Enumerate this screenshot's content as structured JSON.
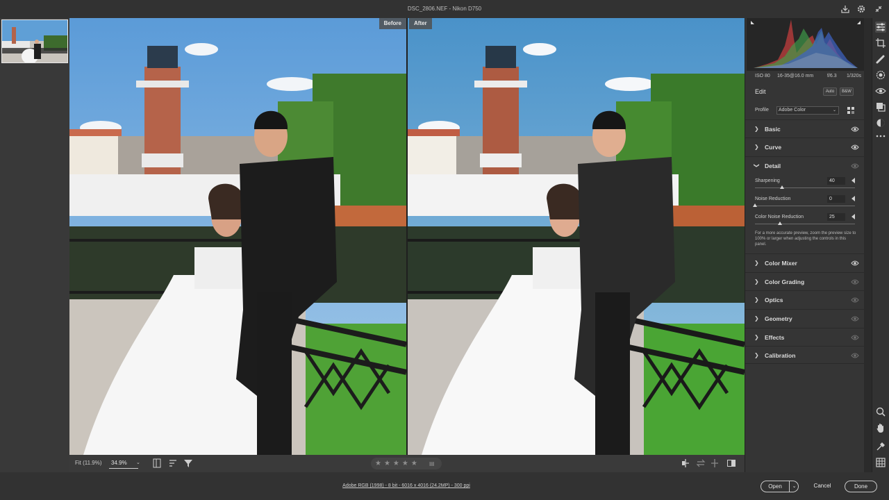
{
  "window": {
    "title": "DSC_2806.NEF  -  Nikon D750"
  },
  "labels": {
    "before": "Before",
    "after": "After"
  },
  "camera_info": {
    "iso": "ISO 80",
    "lens": "16-35@16.0 mm",
    "aperture": "f/6.3",
    "shutter": "1/320s"
  },
  "edit": {
    "title": "Edit",
    "auto_label": "Auto",
    "bw_label": "B&W"
  },
  "profile": {
    "label": "Profile",
    "value": "Adobe Color"
  },
  "sections": [
    {
      "name": "Basic",
      "expanded": false,
      "visible": true
    },
    {
      "name": "Curve",
      "expanded": false,
      "visible": true
    },
    {
      "name": "Detail",
      "expanded": true,
      "visible": false
    },
    {
      "name": "Color Mixer",
      "expanded": false,
      "visible": true
    },
    {
      "name": "Color Grading",
      "expanded": false,
      "visible": false
    },
    {
      "name": "Optics",
      "expanded": false,
      "visible": false
    },
    {
      "name": "Geometry",
      "expanded": false,
      "visible": false
    },
    {
      "name": "Effects",
      "expanded": false,
      "visible": false
    },
    {
      "name": "Calibration",
      "expanded": false,
      "visible": false
    }
  ],
  "detail": {
    "sliders": [
      {
        "label": "Sharpening",
        "value": "40",
        "fraction": 0.27
      },
      {
        "label": "Noise Reduction",
        "value": "0",
        "fraction": 0.0
      },
      {
        "label": "Color Noise Reduction",
        "value": "25",
        "fraction": 0.25
      }
    ],
    "note": "For a more accurate preview, zoom the preview size to 100% or larger when adjusting the controls in this panel."
  },
  "bottom": {
    "fit_label": "Fit (11.9%)",
    "zoom_value": "34.9%",
    "rating": 0
  },
  "status": {
    "file_info": "Adobe RGB (1998) - 8 bit - 6016 x 4016 (24.2MP) - 300 ppi",
    "open_label": "Open",
    "cancel_label": "Cancel",
    "done_label": "Done"
  },
  "colors": {
    "accent": "#e8e8e8",
    "panel_bg": "#353535",
    "canvas_bg": "#4a4a4a"
  },
  "icons": {
    "titlebar": [
      "export-icon",
      "gear-icon",
      "collapse-icon"
    ],
    "tools": [
      "edit-sliders-icon",
      "crop-icon",
      "healing-brush-icon",
      "masking-icon",
      "red-eye-icon",
      "presets-icon",
      "snapshots-icon",
      "more-icon",
      "zoom-icon",
      "hand-icon",
      "color-sampler-icon",
      "grid-icon"
    ]
  }
}
